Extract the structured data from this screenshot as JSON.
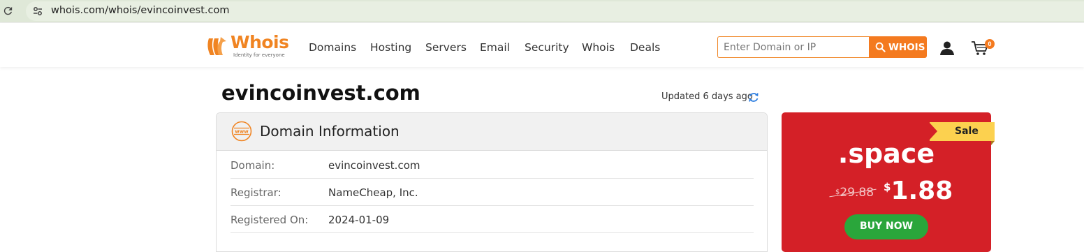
{
  "browser": {
    "url": "whois.com/whois/evincoinvest.com"
  },
  "header": {
    "logo_word": "Whois",
    "logo_tagline": "Identity for everyone",
    "nav": [
      "Domains",
      "Hosting",
      "Servers",
      "Email",
      "Security",
      "Whois",
      "Deals"
    ],
    "search_placeholder": "Enter Domain or IP",
    "search_button": "WHOIS",
    "cart_count": "0",
    "brand_color": "#f47a1f"
  },
  "main": {
    "domain": "evincoinvest.com",
    "updated": "Updated 6 days ago",
    "panel_title": "Domain Information",
    "rows": [
      {
        "label": "Domain:",
        "value": "evincoinvest.com"
      },
      {
        "label": "Registrar:",
        "value": "NameCheap, Inc."
      },
      {
        "label": "Registered On:",
        "value": "2024-01-09"
      }
    ]
  },
  "promo": {
    "badge": "Sale",
    "tld": ".space",
    "old_currency": "$",
    "old_price": "29.88",
    "new_currency": "$",
    "new_price": "1.88",
    "button": "BUY NOW",
    "bg_color": "#d42027"
  }
}
